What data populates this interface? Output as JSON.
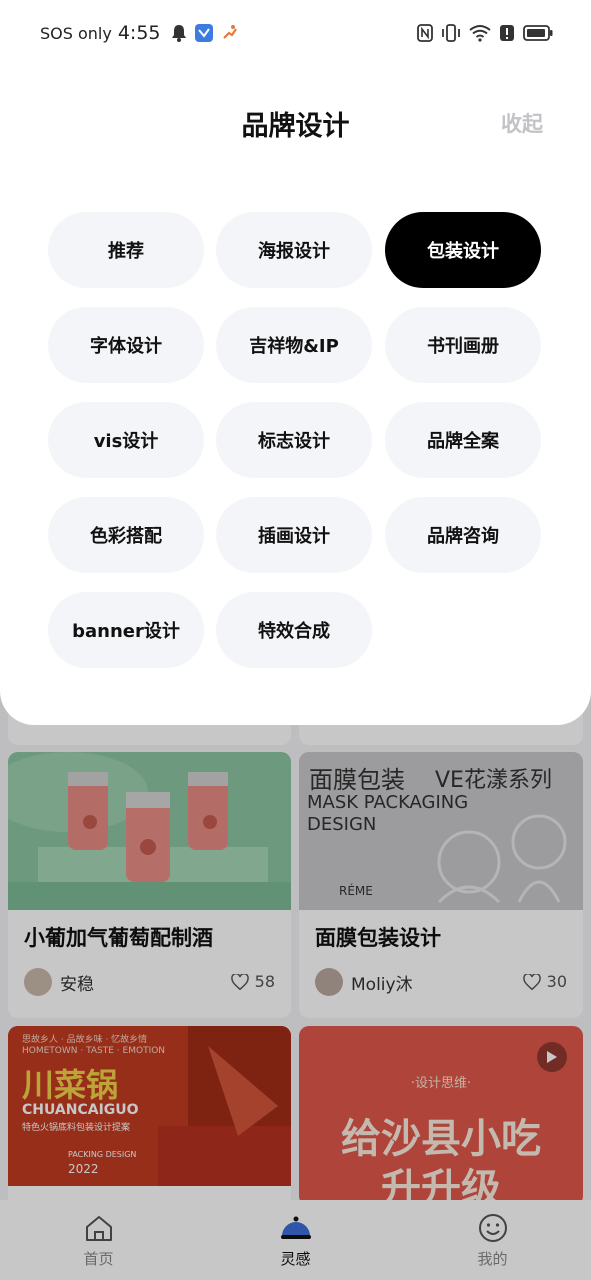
{
  "status_bar": {
    "carrier": "SOS only",
    "time": "4:55"
  },
  "sheet": {
    "title": "品牌设计",
    "collapse_label": "收起",
    "chips": [
      {
        "label": "推荐",
        "selected": false
      },
      {
        "label": "海报设计",
        "selected": false
      },
      {
        "label": "包装设计",
        "selected": true
      },
      {
        "label": "字体设计",
        "selected": false
      },
      {
        "label": "吉祥物&IP",
        "selected": false
      },
      {
        "label": "书刊画册",
        "selected": false
      },
      {
        "label": "vis设计",
        "selected": false
      },
      {
        "label": "标志设计",
        "selected": false
      },
      {
        "label": "品牌全案",
        "selected": false
      },
      {
        "label": "色彩搭配",
        "selected": false
      },
      {
        "label": "插画设计",
        "selected": false
      },
      {
        "label": "品牌咨询",
        "selected": false
      },
      {
        "label": "banner设计",
        "selected": false
      },
      {
        "label": "特效合成",
        "selected": false
      }
    ]
  },
  "feed": {
    "cards": [
      {
        "title": "小葡加气葡萄配制酒",
        "author": "安稳",
        "likes": "58"
      },
      {
        "title": "面膜包装设计",
        "author": "Moliy沐",
        "likes": "30",
        "image_text": [
          "面膜包装",
          "VE花漾系列",
          "MASK PACKAGING",
          "DESIGN",
          "RÉME"
        ]
      },
      {
        "image_text": [
          "思故乡人 · 品故乡味 · 忆故乡情",
          "HOMETOWN · TASTE · EMOTION",
          "川菜锅",
          "CHUANCAIGUO",
          "特色火锅底料包装设计提案",
          "PACKING DESIGN",
          "2022"
        ]
      },
      {
        "image_text": [
          "·设计思维·",
          "给沙县小吃",
          "升升级"
        ]
      }
    ]
  },
  "tabbar": {
    "tabs": [
      {
        "label": "首页",
        "icon": "home-icon"
      },
      {
        "label": "灵感",
        "icon": "inspiration-icon"
      },
      {
        "label": "我的",
        "icon": "profile-icon"
      }
    ],
    "active": 1
  },
  "colors": {
    "selected_chip": "#000000",
    "chip_bg": "#f4f5f8",
    "accent_blue": "#3d6fd8"
  }
}
